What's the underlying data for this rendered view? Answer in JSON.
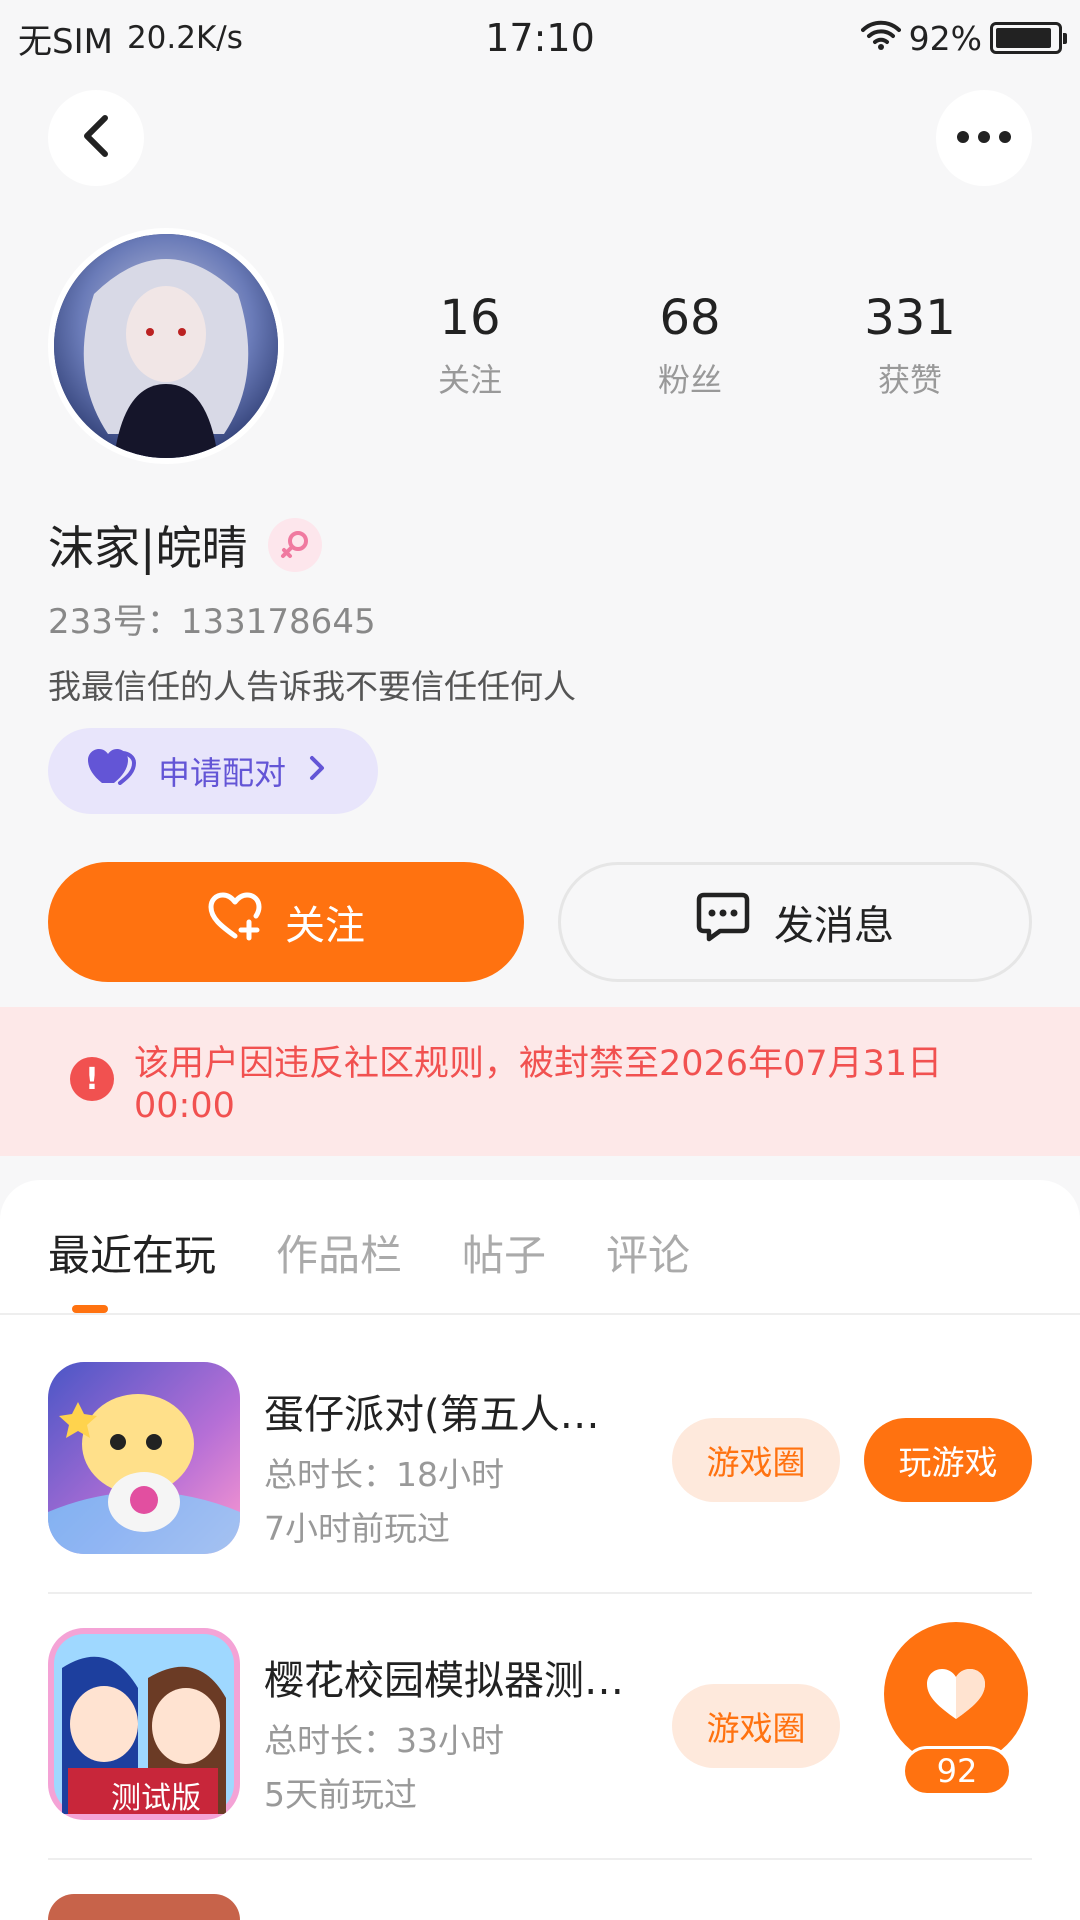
{
  "status_bar": {
    "carrier": "无SIM",
    "net_speed": "20.2K/s",
    "time": "17:10",
    "battery": "92%",
    "battery_level": 0.92
  },
  "nav": {
    "back_icon": "chevron-left-icon",
    "more_icon": "more-dots-icon"
  },
  "profile": {
    "stats": [
      {
        "num": "16",
        "label": "关注"
      },
      {
        "num": "68",
        "label": "粉丝"
      },
      {
        "num": "331",
        "label": "获赞"
      }
    ],
    "nickname": "沫家|皖晴",
    "gender_icon": "female-icon",
    "uid": "233号：133178645",
    "bio": "我最信任的人告诉我不要信任任何人",
    "pair_button": "申请配对",
    "follow_button": "关注",
    "message_button": "发消息"
  },
  "ban_notice": "该用户因违反社区规则，被封禁至2026年07月31日00:00",
  "tabs": [
    "最近在玩",
    "作品栏",
    "帖子",
    "评论"
  ],
  "games": [
    {
      "name": "蛋仔派对(第五人…",
      "duration": "总时长：18小时",
      "last_played": "7小时前玩过",
      "circle_label": "游戏圈",
      "play_label": "玩游戏"
    },
    {
      "name": "樱花校园模拟器测…",
      "duration": "总时长：33小时",
      "last_played": "5天前玩过",
      "circle_label": "游戏圈",
      "icon_badge": "测试版"
    }
  ],
  "float_like": {
    "count": "92"
  },
  "colors": {
    "accent": "#ff7210",
    "ban_red": "#f15150",
    "pair_purple": "#6355d6"
  }
}
